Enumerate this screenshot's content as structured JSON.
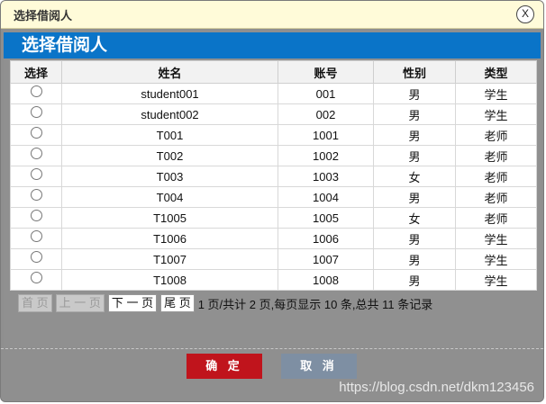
{
  "dialog": {
    "title": "选择借阅人",
    "close_label": "X"
  },
  "banner": {
    "title": "选择借阅人"
  },
  "table": {
    "headers": [
      "选择",
      "姓名",
      "账号",
      "性别",
      "类型"
    ],
    "rows": [
      [
        "student001",
        "001",
        "男",
        "学生"
      ],
      [
        "student002",
        "002",
        "男",
        "学生"
      ],
      [
        "T001",
        "1001",
        "男",
        "老师"
      ],
      [
        "T002",
        "1002",
        "男",
        "老师"
      ],
      [
        "T003",
        "1003",
        "女",
        "老师"
      ],
      [
        "T004",
        "1004",
        "男",
        "老师"
      ],
      [
        "T1005",
        "1005",
        "女",
        "老师"
      ],
      [
        "T1006",
        "1006",
        "男",
        "学生"
      ],
      [
        "T1007",
        "1007",
        "男",
        "学生"
      ],
      [
        "T1008",
        "1008",
        "男",
        "学生"
      ]
    ]
  },
  "pager": {
    "first": "首 页",
    "prev": "上 一 页",
    "next": "下 一 页",
    "last": "尾 页",
    "info": "1 页/共计 2 页,每页显示 10 条,总共 11 条记录"
  },
  "buttons": {
    "ok": "确 定",
    "cancel": "取 消"
  },
  "watermark": "https://blog.csdn.net/dkm123456"
}
